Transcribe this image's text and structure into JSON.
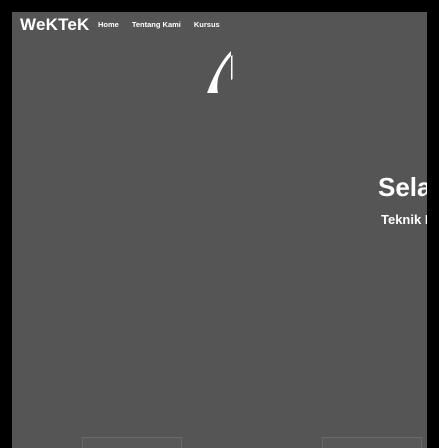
{
  "header": {
    "brand": "WeKTeK",
    "nav": [
      {
        "label": "Home"
      },
      {
        "label": "Tentang Kami"
      },
      {
        "label": "Kursus"
      }
    ]
  },
  "hero": {
    "title": "Sela",
    "subtitle": "Teknik Kompu"
  },
  "colors": {
    "page_bg": "#000000",
    "panel_bg": "#555555",
    "text": "#ffffff"
  },
  "icons": {
    "logo": "wektek-logo-icon"
  }
}
